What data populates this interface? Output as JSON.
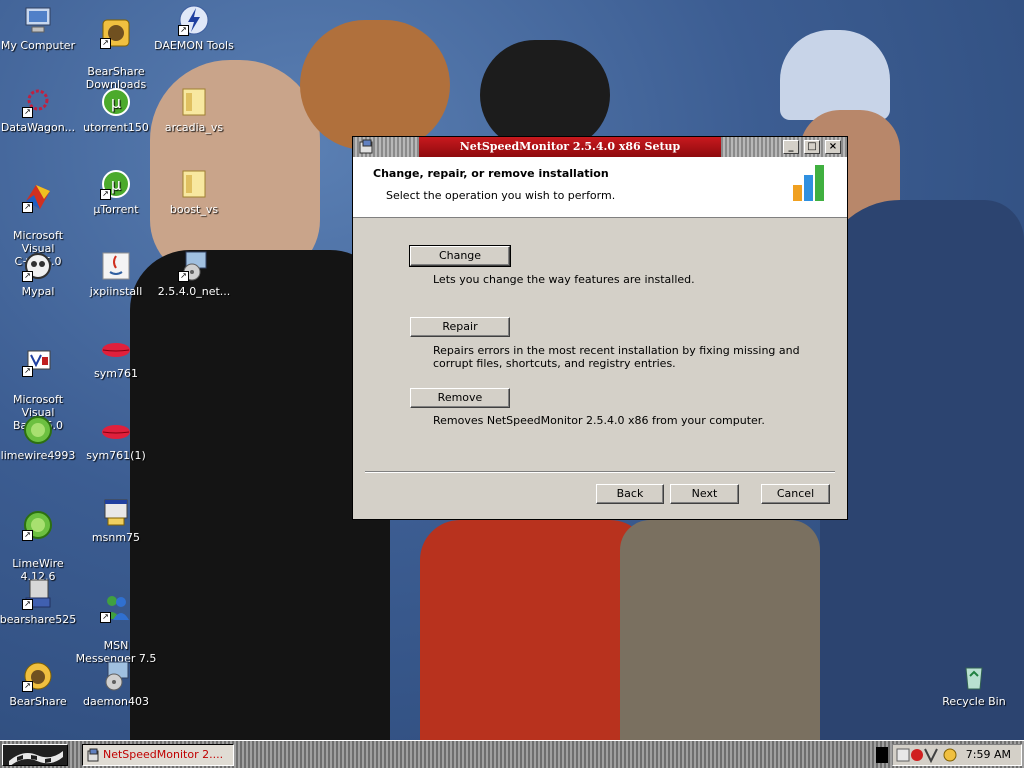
{
  "desktop": {
    "icons": [
      {
        "label": "My Computer",
        "icon": "my-computer-icon"
      },
      {
        "label": "BearShare\nDownloads",
        "icon": "bearshare-icon"
      },
      {
        "label": "DAEMON Tools",
        "icon": "daemon-tools-icon"
      },
      {
        "label": "DataWagon...",
        "icon": "datawagon-icon"
      },
      {
        "label": "utorrent150",
        "icon": "utorrent-icon"
      },
      {
        "label": "arcadia_vs",
        "icon": "folder-icon"
      },
      {
        "label": "Microsoft Visual\nC++ 6.0",
        "icon": "visual-cpp-icon"
      },
      {
        "label": "µTorrent",
        "icon": "utorrent-icon"
      },
      {
        "label": "boost_vs",
        "icon": "folder-icon"
      },
      {
        "label": "Mypal",
        "icon": "mypal-icon"
      },
      {
        "label": "jxpiinstall",
        "icon": "java-icon"
      },
      {
        "label": "2.5.4.0_net...",
        "icon": "installer-icon"
      },
      {
        "label": "Microsoft Visual\nBasic 6.0",
        "icon": "visual-basic-icon"
      },
      {
        "label": "sym761",
        "icon": "lips-icon"
      },
      {
        "label": "limewire4993",
        "icon": "limewire-icon"
      },
      {
        "label": "sym761(1)",
        "icon": "lips-icon"
      },
      {
        "label": "LimeWire\n4.12.6",
        "icon": "limewire-icon"
      },
      {
        "label": "msnm75",
        "icon": "installer-icon"
      },
      {
        "label": "bearshare525",
        "icon": "installer-icon"
      },
      {
        "label": "MSN\nMessenger 7.5",
        "icon": "msn-icon"
      },
      {
        "label": "BearShare",
        "icon": "bearshare-icon"
      },
      {
        "label": "daemon403",
        "icon": "installer-icon"
      },
      {
        "label": "Recycle Bin",
        "icon": "recycle-bin-icon"
      }
    ]
  },
  "dialog": {
    "title": "NetSpeedMonitor 2.5.4.0 x86 Setup",
    "header_title": "Change, repair, or remove installation",
    "header_subtitle": "Select the operation you wish to perform.",
    "operations": [
      {
        "button": "Change",
        "description": "Lets you change the way features are installed."
      },
      {
        "button": "Repair",
        "description": "Repairs errors in the most recent installation by fixing missing and corrupt files, shortcuts, and registry entries."
      },
      {
        "button": "Remove",
        "description": "Removes NetSpeedMonitor 2.5.4.0 x86 from your computer."
      }
    ],
    "back_label": "Back",
    "next_label": "Next",
    "cancel_label": "Cancel"
  },
  "taskbar": {
    "task_label": "NetSpeedMonitor 2....",
    "clock": "7:59 AM"
  },
  "colors": {
    "title_accent": "#c8191e",
    "dialog_face": "#d4d0c8",
    "desktop_blue": "#3c5d92"
  }
}
